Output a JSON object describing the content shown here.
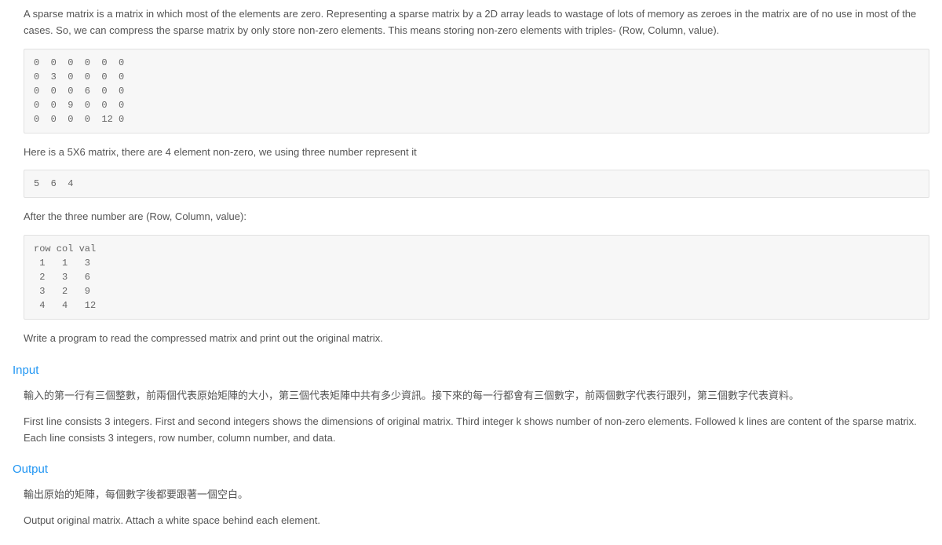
{
  "description": {
    "intro": "A sparse matrix is a matrix in which most of the elements are zero. Representing a sparse matrix by a 2D array leads to wastage of lots of memory as zeroes in the matrix are of no use in most of the cases. So, we can compress the sparse matrix by only store non-zero elements. This means storing non-zero elements with triples- (Row, Column, value).",
    "matrix_block": "0  0  0  0  0  0\n0  3  0  0  0  0\n0  0  0  6  0  0\n0  0  9  0  0  0\n0  0  0  0  12 0",
    "line2": "Here is a 5X6 matrix, there are 4 element non-zero, we using three number represent it",
    "header_block": "5  6  4",
    "line3": "After the three number are (Row, Column, value):",
    "triples_block": "row col val\n 1   1   3\n 2   3   6\n 3   2   9\n 4   4   12",
    "task": "Write a program to read the compressed matrix and print out the original matrix."
  },
  "input": {
    "heading": "Input",
    "line_zh": "輸入的第一行有三個整數，前兩個代表原始矩陣的大小，第三個代表矩陣中共有多少資訊。接下來的每一行都會有三個數字，前兩個數字代表行跟列，第三個數字代表資料。",
    "line_en": "First line consists 3 integers. First and second integers shows the dimensions of original matrix. Third integer k shows number of non-zero elements. Followed k lines are content of the sparse matrix. Each line consists 3 integers, row number, column number, and data."
  },
  "output": {
    "heading": "Output",
    "line_zh": "輸出原始的矩陣，每個數字後都要跟著一個空白。",
    "line_en": "Output original matrix. Attach a white space behind each element."
  }
}
